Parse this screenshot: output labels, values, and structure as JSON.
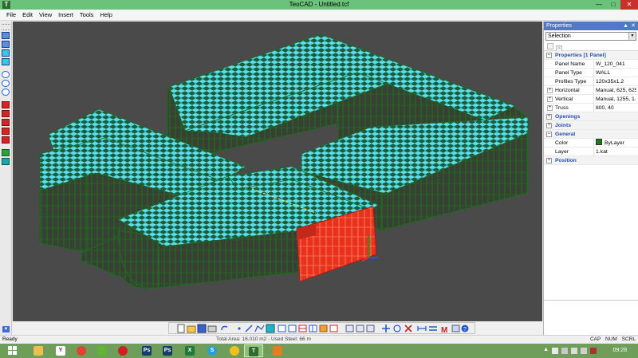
{
  "window": {
    "title": "TeoCAD - Untitled.tcf"
  },
  "menu": {
    "items": [
      "File",
      "Edit",
      "View",
      "Insert",
      "Tools",
      "Help"
    ]
  },
  "properties": {
    "title": "Properties",
    "selection": "Selection",
    "section_title": "Properties [1 Panel]",
    "rows": [
      {
        "name": "Panel Name",
        "value": "W_120_041"
      },
      {
        "name": "Panel Type",
        "value": "WALL"
      },
      {
        "name": "Profiles Type",
        "value": "120x35x1.2"
      },
      {
        "name": "Horizontal",
        "value": "Manual, 625, 625",
        "expandable": true
      },
      {
        "name": "Vertical",
        "value": "Manual, 1255, 1...",
        "expandable": true
      },
      {
        "name": "Truss",
        "value": "800, 40",
        "expandable": true
      }
    ],
    "categories": [
      "Openings",
      "Joints"
    ],
    "general": {
      "label": "General",
      "rows": [
        {
          "name": "Color",
          "value": "ByLayer"
        },
        {
          "name": "Layer",
          "value": "1.kat"
        }
      ]
    },
    "position_label": "Position"
  },
  "status": {
    "ready": "Ready",
    "info": "Total Area: 16.010 m2 - Used Steel: 66 m",
    "keys": [
      "CAP",
      "NUM",
      "SCRL"
    ]
  },
  "taskbar": {
    "clock": "09:28"
  },
  "colors": {
    "title_bar": "#6bc27a",
    "viewport_bg": "#4a4a4a",
    "frame_green": "#1f6b1f",
    "roof_cyan": "#3fd6e6",
    "selected_red": "#e8321e",
    "taskbar": "#6f9e5a"
  }
}
